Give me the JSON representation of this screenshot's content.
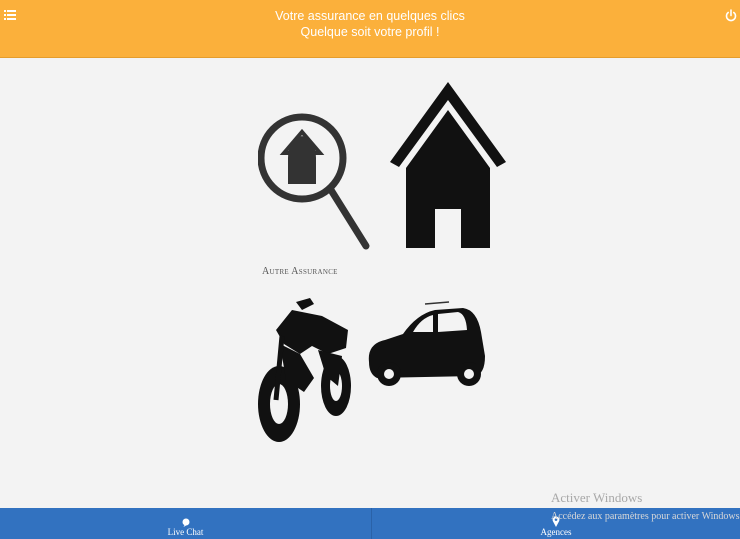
{
  "header": {
    "line1": "Votre assurance en quelques clics",
    "line2": "Quelque soit votre profil !",
    "menu_icon": "menu-list-icon",
    "power_icon": "power-icon"
  },
  "tiles": {
    "other_insurance_caption": "Autre Assurance",
    "other_insurance_icon": "search-house-icon",
    "home_icon": "house-icon",
    "moto_icon": "motorcycle-icon",
    "car_icon": "car-icon"
  },
  "footer": {
    "chat_label": "Live Chat",
    "agencies_label": "Agences",
    "chat_icon": "chat-bubble-icon",
    "agencies_icon": "map-pin-icon"
  },
  "overlay": {
    "activate_title": "Activer Windows",
    "activate_sub": "Accédez aux paramètres pour activer Windows."
  },
  "colors": {
    "header_bg": "#fbb03b",
    "footer_bg": "#3272c0",
    "background": "#f3f3f3"
  }
}
